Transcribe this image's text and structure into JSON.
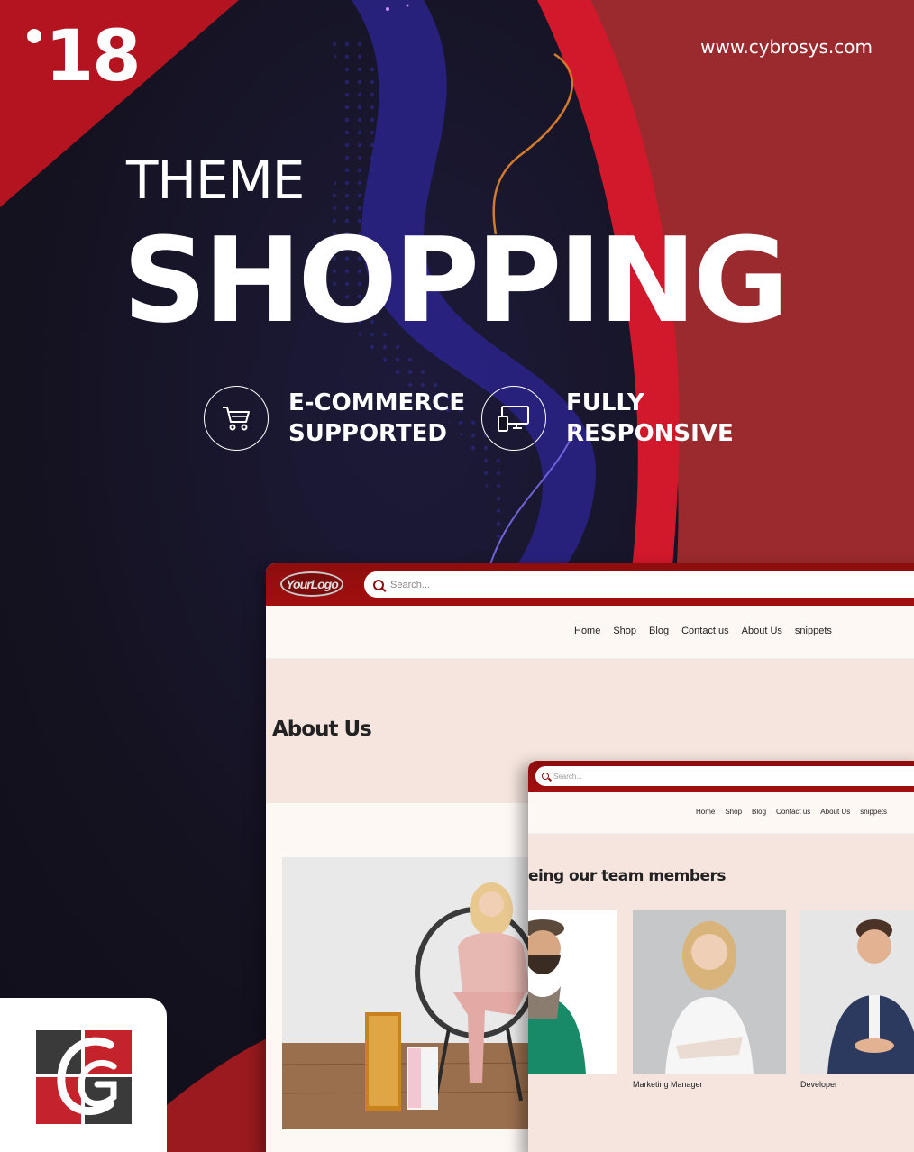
{
  "poster": {
    "version": "18",
    "website": "www.cybrosys.com",
    "theme_label": "THEME",
    "theme_name": "SHOPPING",
    "features": [
      {
        "icon": "cart-icon",
        "line1": "E-COMMERCE",
        "line2": "SUPPORTED"
      },
      {
        "icon": "responsive-devices-icon",
        "line1": "FULLY",
        "line2": "RESPONSIVE"
      }
    ]
  },
  "desktop_mockup": {
    "logo_text": "YourLogo",
    "search_placeholder": "Search...",
    "nav": [
      "Home",
      "Shop",
      "Blog",
      "Contact us",
      "About Us",
      "snippets"
    ],
    "page_title": "About Us"
  },
  "tablet_mockup": {
    "search_placeholder": "Search...",
    "nav": [
      "Home",
      "Shop",
      "Blog",
      "Contact us",
      "About Us",
      "snippets"
    ],
    "section_heading": "eing our team members",
    "team_roles": [
      "",
      "Marketing Manager",
      "Developer"
    ]
  },
  "colors": {
    "brand_red": "#a20f0f",
    "dark_bg": "#14121f",
    "light_bg": "#fdf8f4",
    "hero_bg": "#f6e5df"
  }
}
